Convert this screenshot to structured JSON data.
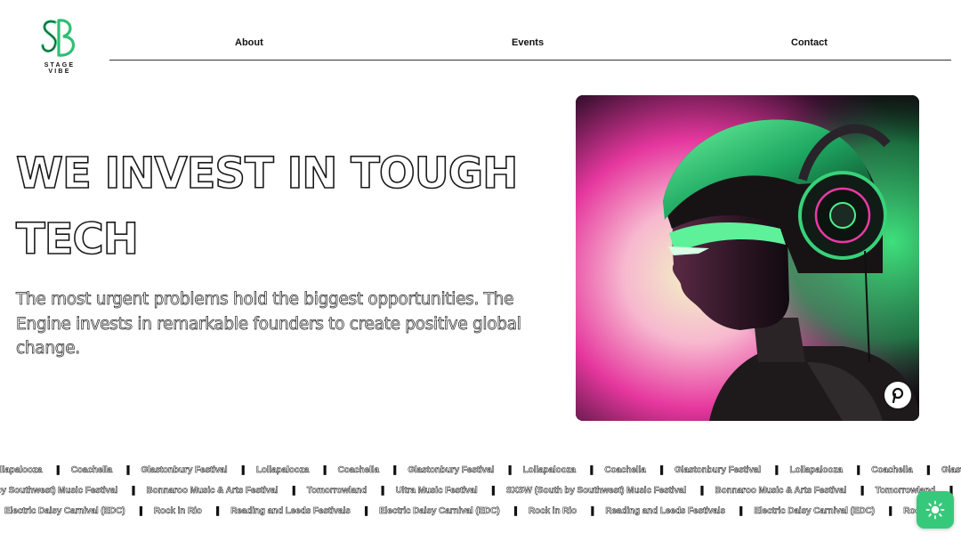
{
  "brand": {
    "wordmark": "STAGE VIBE"
  },
  "nav": {
    "items": [
      "About",
      "Events",
      "Contact"
    ]
  },
  "hero": {
    "title": "WE INVEST IN TOUGH TECH",
    "subtitle": "The most urgent problems hold the biggest opportunities. The Engine invests in remarkable founders to create positive global change."
  },
  "tickers": [
    [
      "Lollapalooza",
      "Coachella",
      "Glastonbury Festival"
    ],
    [
      "SXSW (South by Southwest) Music Festival",
      "Bonnaroo Music & Arts Festival",
      "Tomorrowland",
      "Ultra Music Festival"
    ],
    [
      "Electric Daisy Carnival (EDC)",
      "Rock in Rio",
      "Reading and Leeds Festivals"
    ]
  ],
  "icons": {
    "logo": "sb-monogram-logo",
    "image_badge": "pin-icon",
    "theme_toggle": "sun-icon"
  },
  "colors": {
    "accent_green": "#37c97b",
    "text": "#111111",
    "background": "#ffffff"
  }
}
